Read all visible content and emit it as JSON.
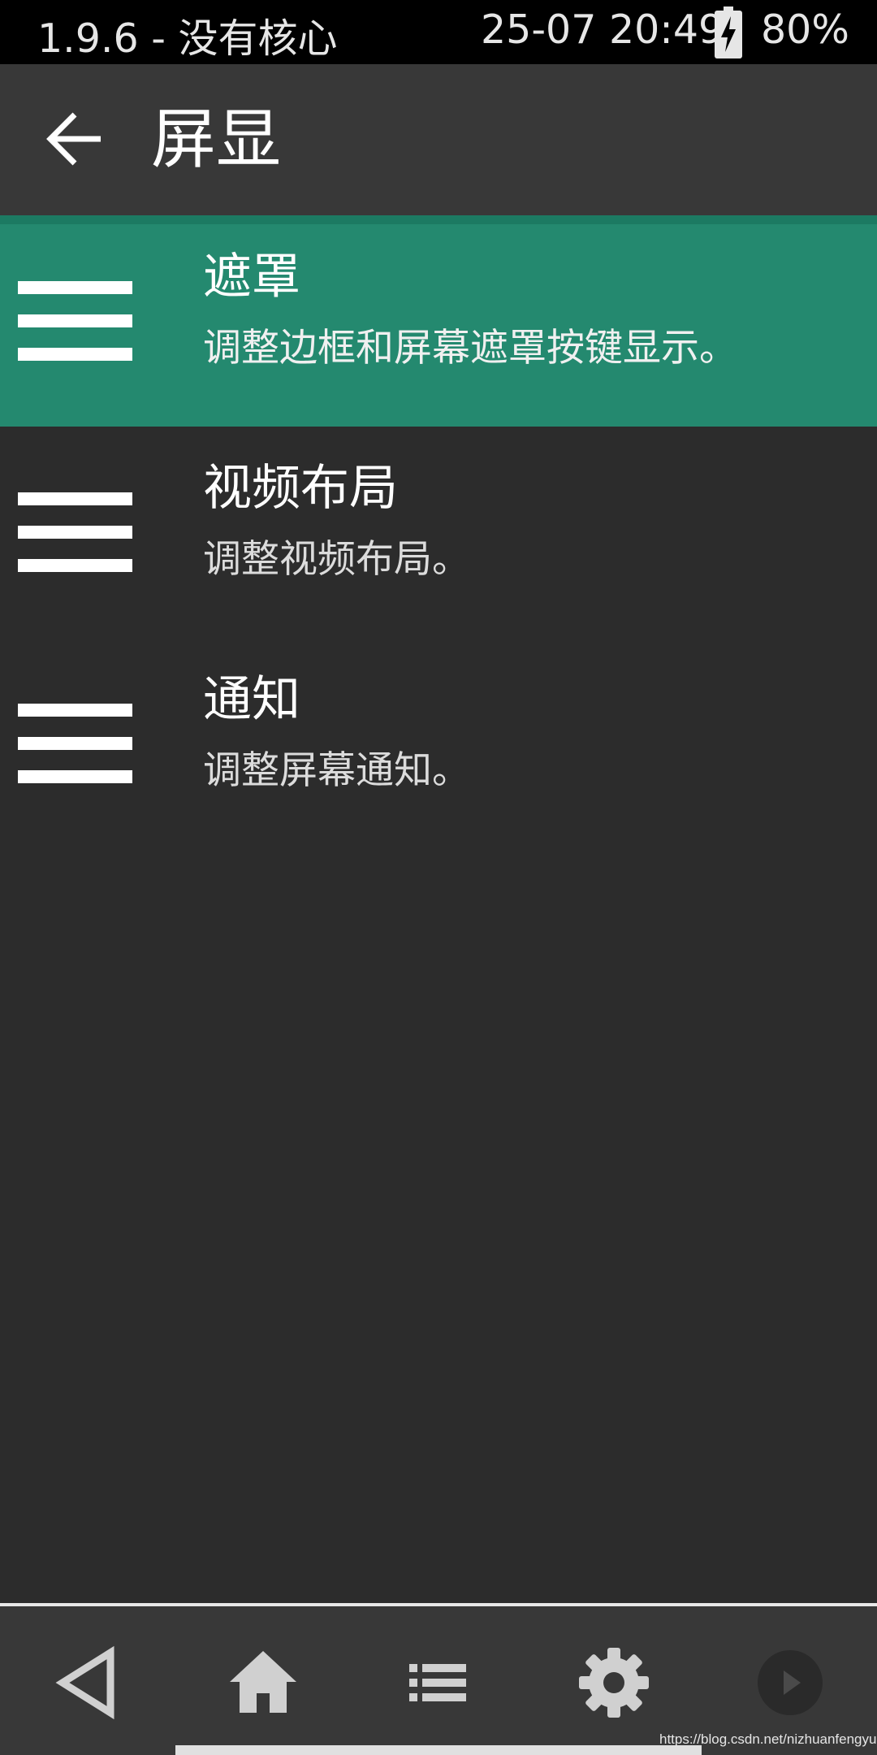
{
  "status_bar": {
    "app_status": "1.9.6 - 没有核心",
    "datetime": "25-07 20:49",
    "battery": "80%",
    "battery_icon": "battery-charging-icon"
  },
  "app_bar": {
    "title": "屏显",
    "back_icon": "arrow-left-icon"
  },
  "menu": {
    "items": [
      {
        "title": "遮罩",
        "description": "调整边框和屏幕遮罩按键显示。",
        "selected": true,
        "icon": "menu-lines-icon"
      },
      {
        "title": "视频布局",
        "description": "调整视频布局。",
        "selected": false,
        "icon": "menu-lines-icon"
      },
      {
        "title": "通知",
        "description": "调整屏幕通知。",
        "selected": false,
        "icon": "menu-lines-icon"
      }
    ]
  },
  "bottom_nav": {
    "buttons": [
      "back-triangle-icon",
      "home-icon",
      "list-icon",
      "gear-icon",
      "play-icon"
    ]
  },
  "watermark": "https://blog.csdn.net/nizhuanfengyun",
  "colors": {
    "accent": "#24896f",
    "background": "#2c2c2c",
    "bar": "#383838"
  }
}
